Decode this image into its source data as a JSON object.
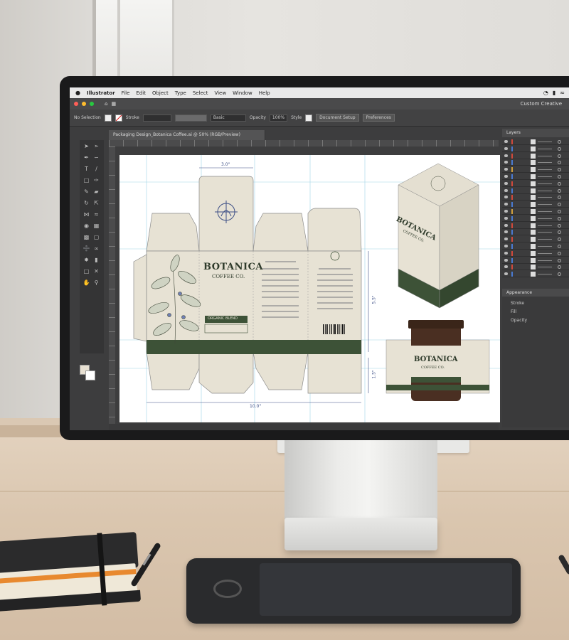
{
  "menubar": {
    "apple": "",
    "app": "Illustrator",
    "items": [
      "File",
      "Edit",
      "Object",
      "Type",
      "Select",
      "View",
      "Window",
      "Help"
    ]
  },
  "appbar": {
    "workspace": "Custom Creative"
  },
  "controlbar": {
    "selection": "No Selection",
    "stroke_label": "Stroke",
    "basic": "Basic",
    "opacity_label": "Opacity",
    "opacity": "100%",
    "style_label": "Style",
    "doc_setup": "Document Setup",
    "preferences": "Preferences"
  },
  "document": {
    "tab_title": "Packaging Design_Botanica Coffee.ai @ 50% (RGB/Preview)"
  },
  "dieline": {
    "brand": "BOTANICA",
    "subtitle": "COFFEE CO.",
    "variety": "ORGANIC BLEND",
    "dim_width": "3.0\"",
    "dim_total": "10.0\"",
    "dim_height": "5.5\"",
    "dim_flap": "1.5\""
  },
  "box_mockup": {
    "brand": "BOTANICA",
    "subtitle": "COFFEE CO."
  },
  "jar_mockup": {
    "brand": "BOTANICA",
    "subtitle": "COFFEE CO."
  },
  "panels": {
    "layers_title": "Layers",
    "appearance_title": "Appearance",
    "appearance_rows": [
      "Stroke",
      "Fill",
      "Opacity"
    ]
  },
  "colors": {
    "green": "#3d5237",
    "cream": "#e7e2d4",
    "navy": "#3d4f86",
    "jar": "#4a2f22"
  }
}
